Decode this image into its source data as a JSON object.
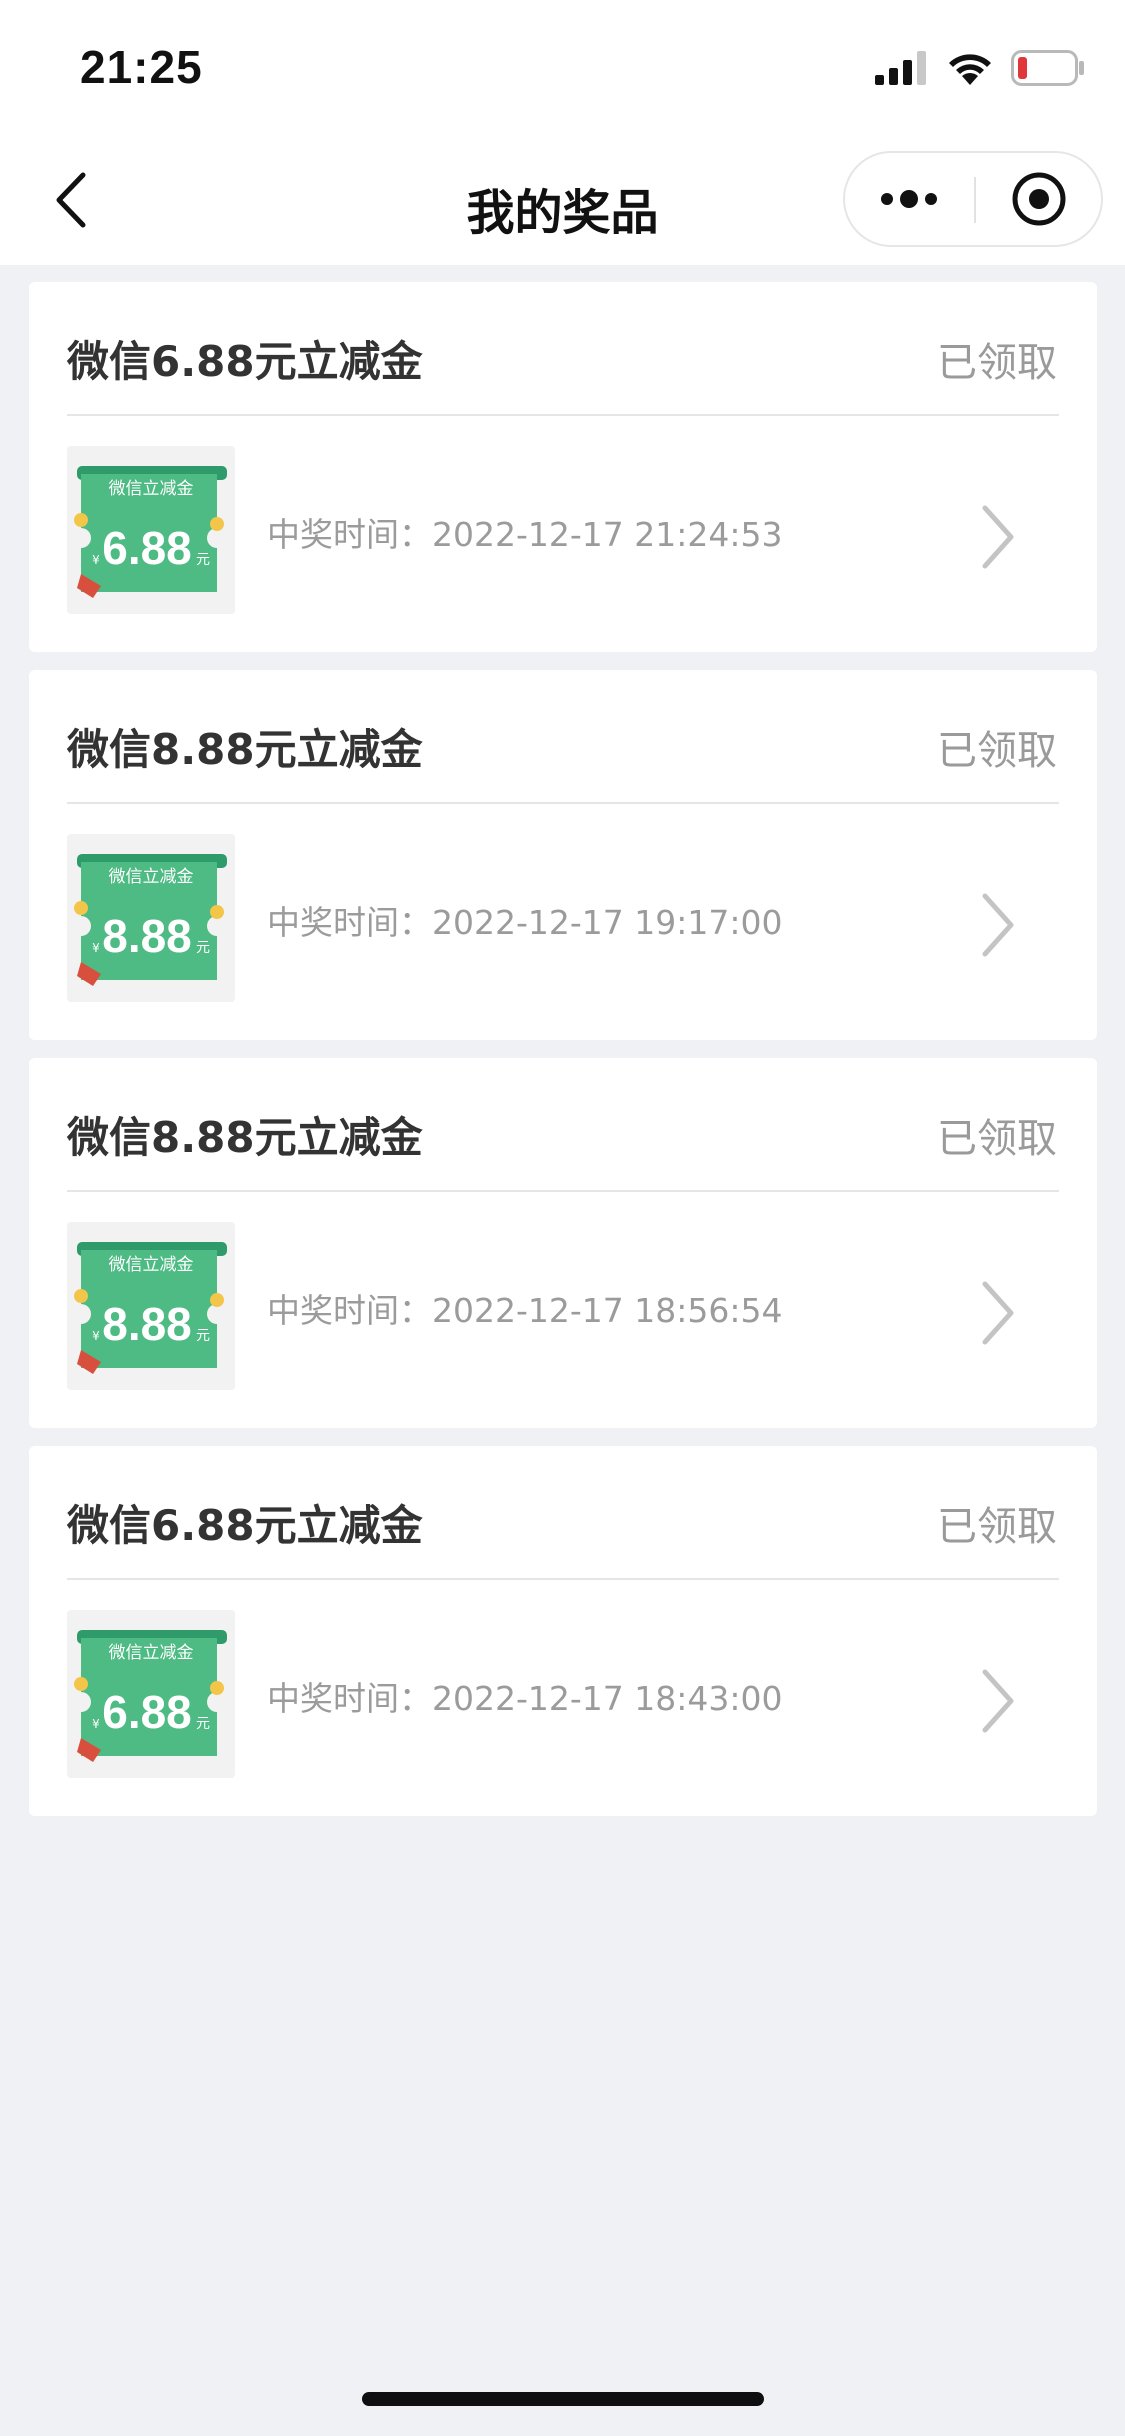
{
  "status_bar": {
    "time": "21:25"
  },
  "nav": {
    "title": "我的奖品"
  },
  "prizes": [
    {
      "title": "微信6.88元立减金",
      "status": "已领取",
      "badge_top": "微信立减金",
      "amount": "6.88",
      "unit": "元",
      "currency": "¥",
      "time_label": "中奖时间：",
      "time_value": "2022-12-17 21:24:53"
    },
    {
      "title": "微信8.88元立减金",
      "status": "已领取",
      "badge_top": "微信立减金",
      "amount": "8.88",
      "unit": "元",
      "currency": "¥",
      "time_label": "中奖时间：",
      "time_value": "2022-12-17 19:17:00"
    },
    {
      "title": "微信8.88元立减金",
      "status": "已领取",
      "badge_top": "微信立减金",
      "amount": "8.88",
      "unit": "元",
      "currency": "¥",
      "time_label": "中奖时间：",
      "time_value": "2022-12-17 18:56:54"
    },
    {
      "title": "微信6.88元立减金",
      "status": "已领取",
      "badge_top": "微信立减金",
      "amount": "6.88",
      "unit": "元",
      "currency": "¥",
      "time_label": "中奖时间：",
      "time_value": "2022-12-17 18:43:00"
    }
  ],
  "colors": {
    "background": "#f0f1f4",
    "card": "#ffffff",
    "coupon_green": "#4dbb83",
    "coupon_dark": "#2f9b6a",
    "battery_low": "#e0383a"
  }
}
